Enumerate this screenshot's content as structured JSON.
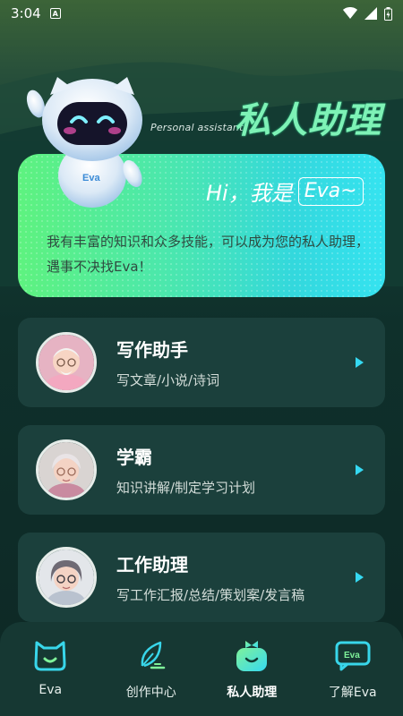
{
  "status": {
    "time": "3:04",
    "notif_icon": "a-icon",
    "icons": [
      "wifi-icon",
      "signal-icon",
      "battery-icon"
    ]
  },
  "header": {
    "subtitle": "Personal assistant",
    "title": "私人助理",
    "robot_badge": "Eva"
  },
  "intro": {
    "greeting": "Hi，我是",
    "name": "Eva~",
    "text": "我有丰富的知识和众多技能，可以成为您的私人助理，遇事不决找Eva！"
  },
  "cards": [
    {
      "name": "写作助手",
      "desc": "写文章/小说/诗词",
      "avatar": "elder-man-avatar"
    },
    {
      "name": "学霸",
      "desc": "知识讲解/制定学习计划",
      "avatar": "scholar-avatar"
    },
    {
      "name": "工作助理",
      "desc": "写工作汇报/总结/策划案/发言稿",
      "avatar": "office-woman-avatar"
    }
  ],
  "tabs": [
    {
      "label": "Eva",
      "icon": "cat-face-icon",
      "active": false
    },
    {
      "label": "创作中心",
      "icon": "feather-pen-icon",
      "active": false
    },
    {
      "label": "私人助理",
      "icon": "assistant-bot-icon",
      "active": true
    },
    {
      "label": "了解Eva",
      "icon": "eva-chat-icon",
      "active": false
    }
  ],
  "colors": {
    "accent": "#35d9f2",
    "title": "#7ef2b6",
    "card_bg": "#1b403c"
  }
}
